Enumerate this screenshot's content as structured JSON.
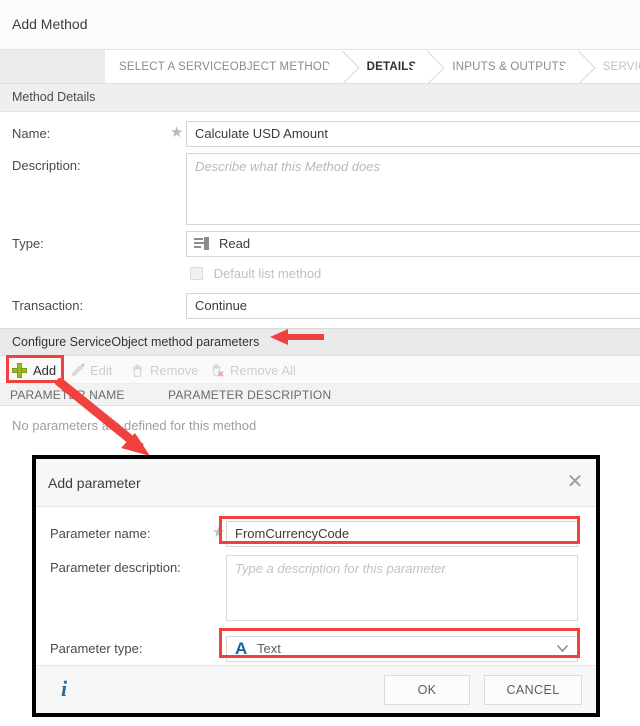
{
  "window": {
    "title": "Add Method"
  },
  "wizard": {
    "steps": [
      {
        "label": "SELECT A SERVICEOBJECT METHOD",
        "state": "done"
      },
      {
        "label": "DETAILS",
        "state": "active"
      },
      {
        "label": "INPUTS & OUTPUTS",
        "state": "done"
      },
      {
        "label": "SERVICEOBJECT",
        "state": "future"
      }
    ]
  },
  "method_details": {
    "section_title": "Method Details",
    "name_label": "Name:",
    "name_value": "Calculate USD Amount",
    "name_required_marker": "★",
    "description_label": "Description:",
    "description_placeholder": "Describe what this Method does",
    "description_value": "",
    "type_label": "Type:",
    "type_value": "Read",
    "type_icon": "read-list-icon",
    "default_list_label": "Default list method",
    "default_list_checked": false,
    "transaction_label": "Transaction:",
    "transaction_value": "Continue"
  },
  "parameters": {
    "section_title": "Configure ServiceObject method parameters",
    "toolbar": [
      {
        "label": "Add",
        "icon": "plus-icon",
        "enabled": true
      },
      {
        "label": "Edit",
        "icon": "pencil-icon",
        "enabled": false
      },
      {
        "label": "Remove",
        "icon": "trash-icon",
        "enabled": false
      },
      {
        "label": "Remove All",
        "icon": "trash-x-icon",
        "enabled": false
      }
    ],
    "columns": [
      "PARAMETER NAME",
      "PARAMETER DESCRIPTION"
    ],
    "empty_message": "No parameters are defined for this method",
    "rows": []
  },
  "dialog": {
    "title": "Add parameter",
    "close_icon": "close-icon",
    "name_label": "Parameter name:",
    "name_required_marker": "★",
    "name_value": "FromCurrencyCode",
    "name_placeholder": "",
    "description_label": "Parameter description:",
    "description_placeholder": "Type a description for this parameter",
    "description_value": "",
    "type_label": "Parameter type:",
    "type_value": "Text",
    "type_icon_glyph": "A",
    "type_caret_icon": "chevron-down-icon",
    "info_icon": "info-icon",
    "ok_label": "OK",
    "cancel_label": "CANCEL"
  },
  "annotations": {
    "accent_color": "#f04040",
    "arrow_to_section_title": "left-arrow",
    "arrow_add_to_dialog": "diagonal-arrow",
    "highlights": [
      "add-button",
      "parameter-name-field",
      "parameter-type-field"
    ]
  }
}
